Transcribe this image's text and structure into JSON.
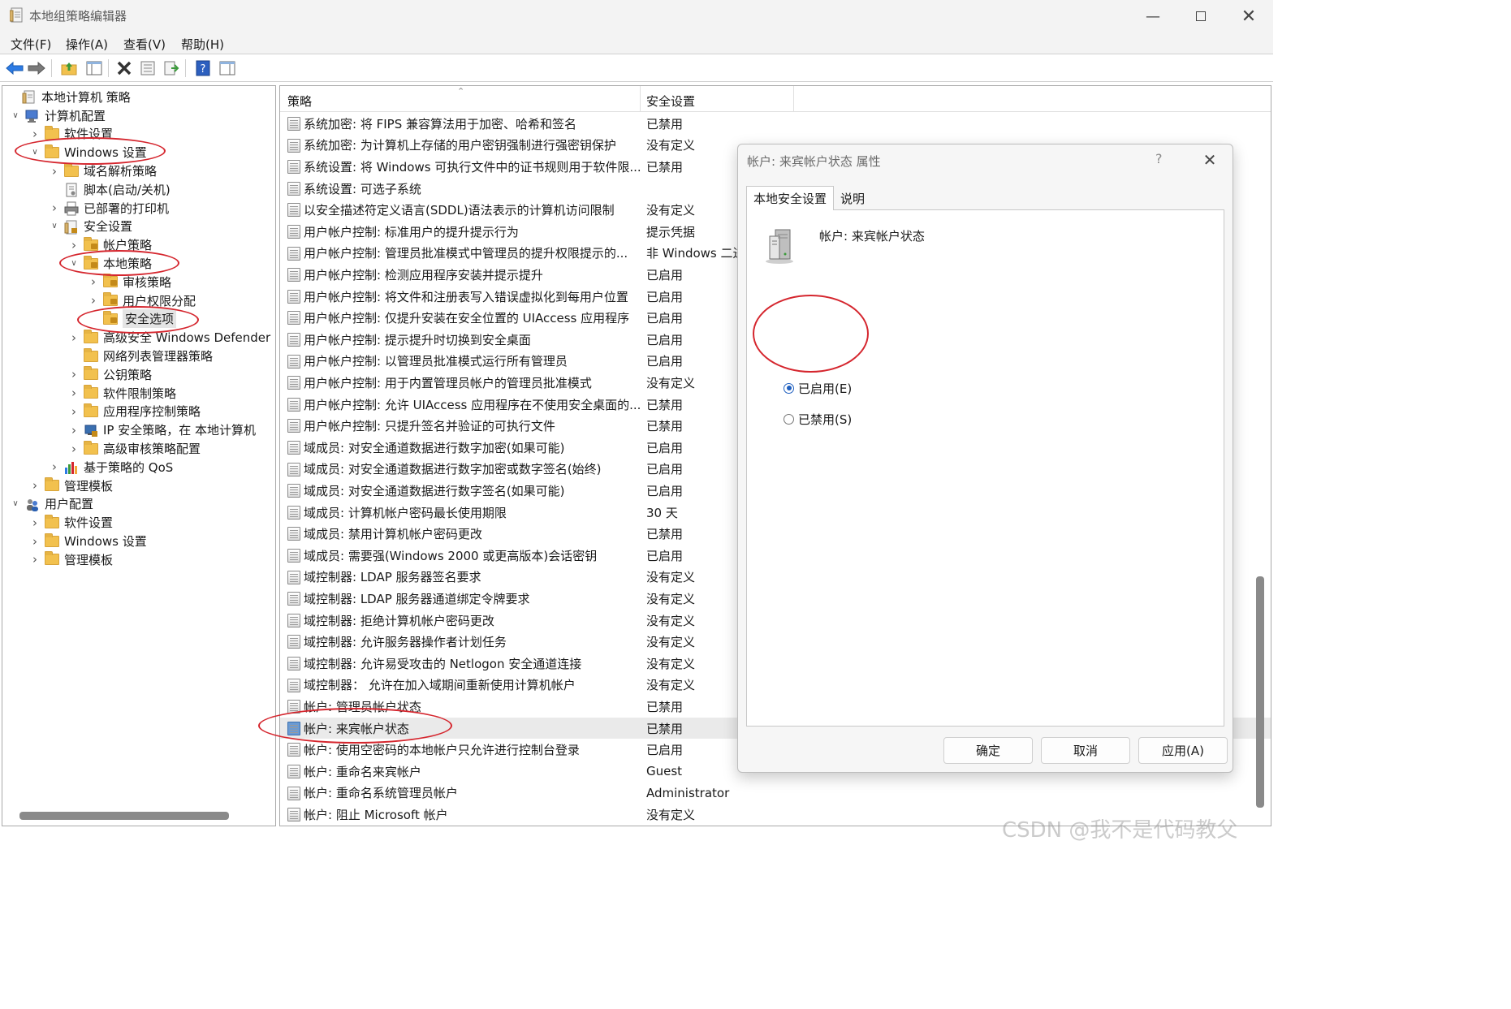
{
  "window": {
    "title": "本地组策略编辑器"
  },
  "menu": [
    {
      "label": "文件(F)"
    },
    {
      "label": "操作(A)"
    },
    {
      "label": "查看(V)"
    },
    {
      "label": "帮助(H)"
    }
  ],
  "tree": [
    {
      "label": "本地计算机 策略"
    },
    {
      "label": "计算机配置"
    },
    {
      "label": "软件设置"
    },
    {
      "label": "Windows 设置"
    },
    {
      "label": "域名解析策略"
    },
    {
      "label": "脚本(启动/关机)"
    },
    {
      "label": "已部署的打印机"
    },
    {
      "label": "安全设置"
    },
    {
      "label": "帐户策略"
    },
    {
      "label": "本地策略"
    },
    {
      "label": "审核策略"
    },
    {
      "label": "用户权限分配"
    },
    {
      "label": "安全选项"
    },
    {
      "label": "高级安全 Windows Defender 防"
    },
    {
      "label": "网络列表管理器策略"
    },
    {
      "label": "公钥策略"
    },
    {
      "label": "软件限制策略"
    },
    {
      "label": "应用程序控制策略"
    },
    {
      "label": "IP 安全策略，在 本地计算机"
    },
    {
      "label": "高级审核策略配置"
    },
    {
      "label": "基于策略的 QoS"
    },
    {
      "label": "管理模板"
    },
    {
      "label": "用户配置"
    },
    {
      "label": "软件设置"
    },
    {
      "label": "Windows 设置"
    },
    {
      "label": "管理模板"
    }
  ],
  "list": {
    "col_policy": "策略",
    "col_setting": "安全设置",
    "rows": [
      {
        "policy": "系统加密: 将 FIPS 兼容算法用于加密、哈希和签名",
        "setting": "已禁用"
      },
      {
        "policy": "系统加密: 为计算机上存储的用户密钥强制进行强密钥保护",
        "setting": "没有定义"
      },
      {
        "policy": "系统设置: 将 Windows 可执行文件中的证书规则用于软件限...",
        "setting": "已禁用"
      },
      {
        "policy": "系统设置: 可选子系统",
        "setting": ""
      },
      {
        "policy": "以安全描述符定义语言(SDDL)语法表示的计算机访问限制",
        "setting": "没有定义"
      },
      {
        "policy": "用户帐户控制: 标准用户的提升提示行为",
        "setting": "提示凭据"
      },
      {
        "policy": "用户帐户控制: 管理员批准模式中管理员的提升权限提示的...",
        "setting": "非 Windows 二进"
      },
      {
        "policy": "用户帐户控制: 检测应用程序安装并提示提升",
        "setting": "已启用"
      },
      {
        "policy": "用户帐户控制: 将文件和注册表写入错误虚拟化到每用户位置",
        "setting": "已启用"
      },
      {
        "policy": "用户帐户控制: 仅提升安装在安全位置的 UIAccess 应用程序",
        "setting": "已启用"
      },
      {
        "policy": "用户帐户控制: 提示提升时切换到安全桌面",
        "setting": "已启用"
      },
      {
        "policy": "用户帐户控制: 以管理员批准模式运行所有管理员",
        "setting": "已启用"
      },
      {
        "policy": "用户帐户控制: 用于内置管理员帐户的管理员批准模式",
        "setting": "没有定义"
      },
      {
        "policy": "用户帐户控制: 允许 UIAccess 应用程序在不使用安全桌面的...",
        "setting": "已禁用"
      },
      {
        "policy": "用户帐户控制: 只提升签名并验证的可执行文件",
        "setting": "已禁用"
      },
      {
        "policy": "域成员: 对安全通道数据进行数字加密(如果可能)",
        "setting": "已启用"
      },
      {
        "policy": "域成员: 对安全通道数据进行数字加密或数字签名(始终)",
        "setting": "已启用"
      },
      {
        "policy": "域成员: 对安全通道数据进行数字签名(如果可能)",
        "setting": "已启用"
      },
      {
        "policy": "域成员: 计算机帐户密码最长使用期限",
        "setting": "30 天"
      },
      {
        "policy": "域成员: 禁用计算机帐户密码更改",
        "setting": "已禁用"
      },
      {
        "policy": "域成员: 需要强(Windows 2000 或更高版本)会话密钥",
        "setting": "已启用"
      },
      {
        "policy": "域控制器: LDAP 服务器签名要求",
        "setting": "没有定义"
      },
      {
        "policy": "域控制器: LDAP 服务器通道绑定令牌要求",
        "setting": "没有定义"
      },
      {
        "policy": "域控制器: 拒绝计算机帐户密码更改",
        "setting": "没有定义"
      },
      {
        "policy": "域控制器: 允许服务器操作者计划任务",
        "setting": "没有定义"
      },
      {
        "policy": "域控制器: 允许易受攻击的 Netlogon 安全通道连接",
        "setting": "没有定义"
      },
      {
        "policy": "域控制器： 允许在加入域期间重新使用计算机帐户",
        "setting": "没有定义"
      },
      {
        "policy": "帐户: 管理员帐户状态",
        "setting": "已禁用"
      },
      {
        "policy": "帐户: 来宾帐户状态",
        "setting": "已禁用"
      },
      {
        "policy": "帐户: 使用空密码的本地帐户只允许进行控制台登录",
        "setting": "已启用"
      },
      {
        "policy": "帐户: 重命名来宾帐户",
        "setting": "Guest"
      },
      {
        "policy": "帐户: 重命名系统管理员帐户",
        "setting": "Administrator"
      },
      {
        "policy": "帐户: 阻止 Microsoft 帐户",
        "setting": "没有定义"
      }
    ]
  },
  "dialog": {
    "title": "帐户: 来宾帐户状态 属性",
    "help": "?",
    "tabs": [
      "本地安全设置",
      "说明"
    ],
    "policy_name": "帐户: 来宾帐户状态",
    "options": [
      {
        "label": "已启用(E)",
        "checked": true
      },
      {
        "label": "已禁用(S)",
        "checked": false
      }
    ],
    "buttons": {
      "ok": "确定",
      "cancel": "取消",
      "apply": "应用(A)"
    }
  },
  "watermark": "CSDN @我不是代码教父",
  "colors": {
    "annotation": "#d5262e",
    "selection": "#e4e4e4",
    "radio_checked": "#1f5fbf"
  }
}
